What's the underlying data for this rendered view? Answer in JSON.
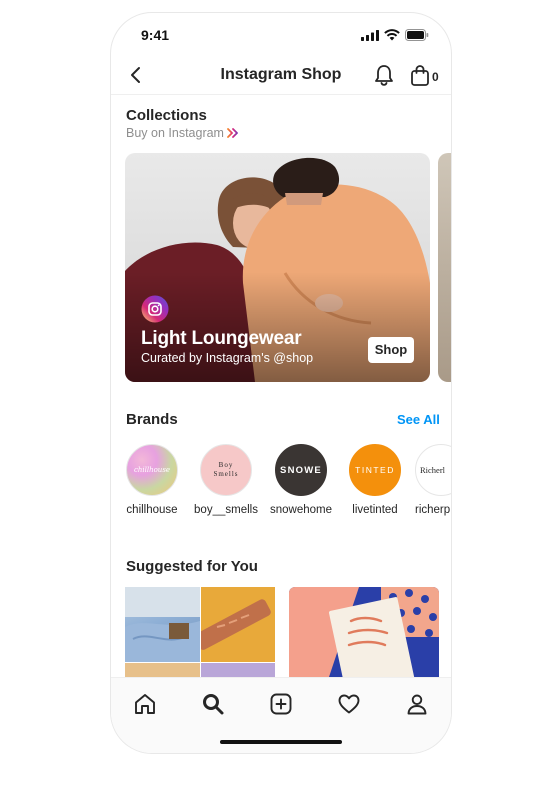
{
  "status_bar": {
    "time": "9:41"
  },
  "header": {
    "title": "Instagram Shop",
    "bag_count": "0"
  },
  "collections": {
    "title": "Collections",
    "subtitle": "Buy on Instagram",
    "card": {
      "title": "Light Loungewear",
      "subtitle": "Curated by Instagram's @shop",
      "shop_label": "Shop"
    }
  },
  "brands": {
    "title": "Brands",
    "see_all": "See All",
    "items": [
      {
        "label": "chillhouse",
        "logo_text": "chillhouse"
      },
      {
        "label": "boy__smells",
        "logo_text": "Boy Smells"
      },
      {
        "label": "snowehome",
        "logo_text": "SNOWE"
      },
      {
        "label": "livetinted",
        "logo_text": "TINTED"
      },
      {
        "label": "richerp",
        "logo_text": "Richerl"
      }
    ]
  },
  "suggested": {
    "title": "Suggested for You"
  },
  "colors": {
    "accent_blue": "#0095f6",
    "text": "#262626",
    "muted": "#8e8e8e"
  },
  "icons": [
    "back-icon",
    "bell-icon",
    "bag-icon",
    "instagram-icon",
    "home-icon",
    "search-icon",
    "add-icon",
    "heart-icon",
    "profile-icon"
  ]
}
